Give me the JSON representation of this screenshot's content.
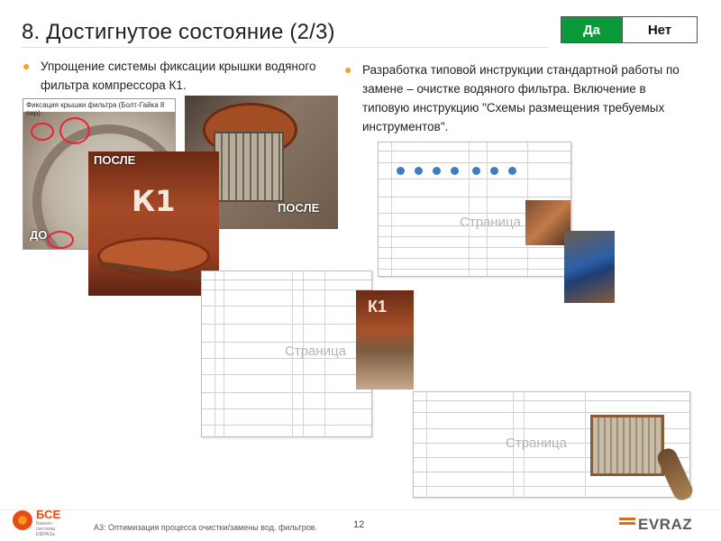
{
  "title": "8. Достигнутое состояние (2/3)",
  "toggle": {
    "yes": "Да",
    "no": "Нет",
    "active_color": "#0a9a3a"
  },
  "bullets": {
    "left": "Упрощение системы фиксации крышки водяного фильтра  компрессора К1.",
    "right": "Разработка типовой инструкции стандартной работы по замене – очистке водяного фильтра. Включение в типовую инструкцию \"Схемы размещения требуемых инструментов\"."
  },
  "photos": {
    "before_caption": "Фиксация крышки фильтра (Болт-Гайка 8 пар)",
    "before_label": "ДО",
    "after_label_1": "ПОСЛЕ",
    "after_label_2": "ПОСЛЕ",
    "k1_mark": "К1"
  },
  "documents": {
    "watermark": "Страница"
  },
  "footer": {
    "logo_text": "БСЕ",
    "logo_sub": "Бизнес-система ЕВРАЗа",
    "text": "A3:  Оптимизация процесса очистки/замены вод. фильтров.",
    "page": "12",
    "brand": "EVRAZ",
    "brand_color": "#e56a1c"
  }
}
